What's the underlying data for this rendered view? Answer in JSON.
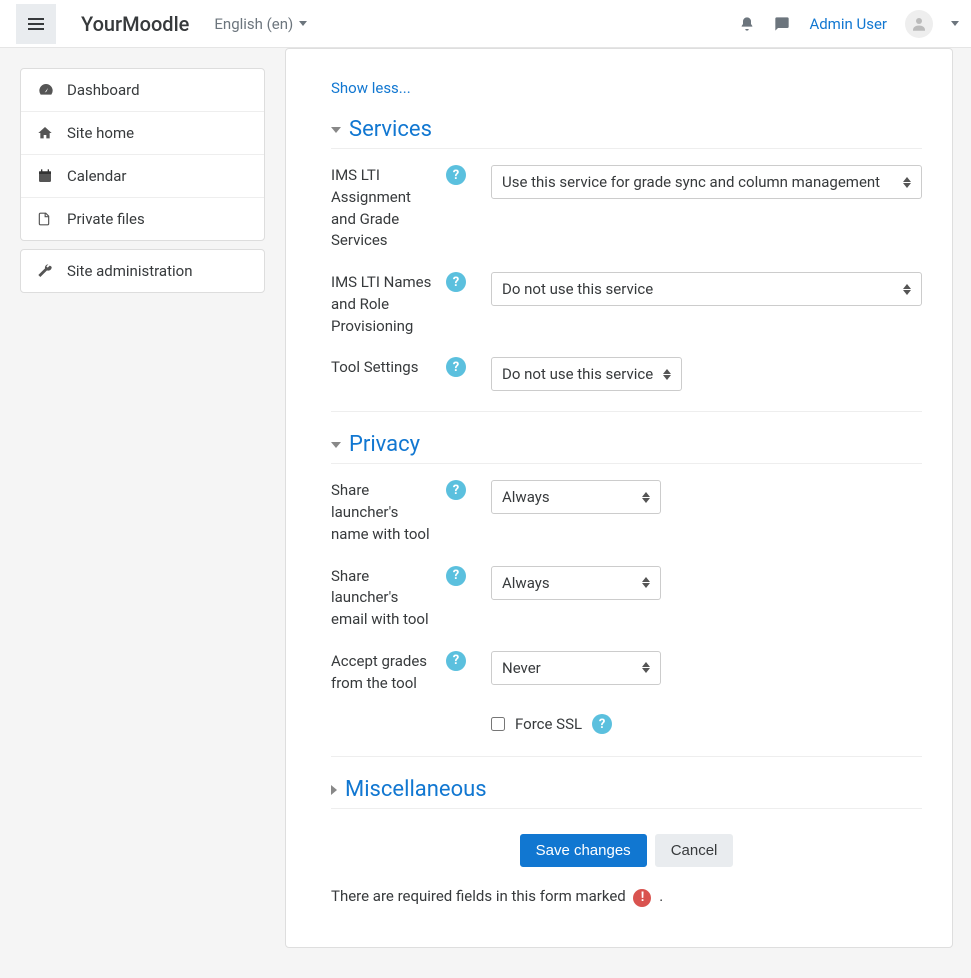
{
  "header": {
    "brand": "YourMoodle",
    "language": "English (en)",
    "user": "Admin User"
  },
  "sidebar": {
    "items": [
      {
        "label": "Dashboard",
        "icon": "gauge"
      },
      {
        "label": "Site home",
        "icon": "home"
      },
      {
        "label": "Calendar",
        "icon": "calendar"
      },
      {
        "label": "Private files",
        "icon": "file"
      }
    ],
    "admin": {
      "label": "Site administration",
      "icon": "wrench"
    }
  },
  "form": {
    "show_less": "Show less...",
    "sections": {
      "services": {
        "title": "Services",
        "fields": {
          "lti_grade": {
            "label": "IMS LTI Assignment and Grade Services",
            "value": "Use this service for grade sync and column management"
          },
          "lti_names": {
            "label": "IMS LTI Names and Role Provisioning",
            "value": "Do not use this service"
          },
          "tool_settings": {
            "label": "Tool Settings",
            "value": "Do not use this service"
          }
        }
      },
      "privacy": {
        "title": "Privacy",
        "fields": {
          "share_name": {
            "label": "Share launcher's name with tool",
            "value": "Always"
          },
          "share_email": {
            "label": "Share launcher's email with tool",
            "value": "Always"
          },
          "accept_grades": {
            "label": "Accept grades from the tool",
            "value": "Never"
          },
          "force_ssl": {
            "label": "Force SSL",
            "checked": false
          }
        }
      },
      "misc": {
        "title": "Miscellaneous"
      }
    },
    "actions": {
      "save": "Save changes",
      "cancel": "Cancel"
    },
    "required_note": "There are required fields in this form marked"
  }
}
